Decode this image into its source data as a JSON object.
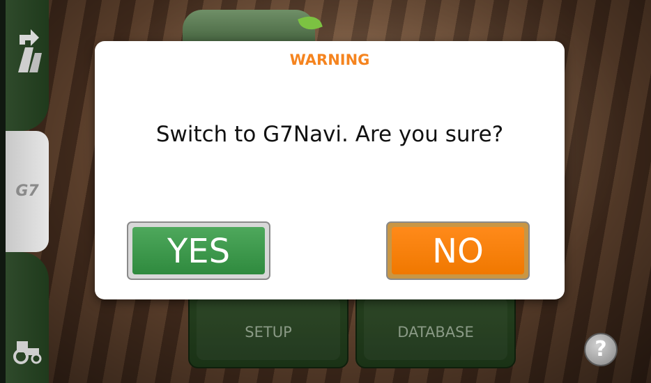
{
  "dialog": {
    "title": "WARNING",
    "message": "Switch to G7Navi. Are you sure?",
    "yes_label": "YES",
    "no_label": "NO"
  },
  "sidebar": {
    "logo_text": "G7"
  },
  "menu": {
    "setup_label": "SETUP",
    "database_label": "DATABASE"
  },
  "help": {
    "label": "?"
  },
  "colors": {
    "accent_orange": "#f5841f",
    "yes_green": "#3f9a4e",
    "no_orange": "#ff8200",
    "sidebar_green": "#2a4626"
  },
  "icons": [
    "route-icon",
    "g7-logo-icon",
    "tractor-icon",
    "help-icon"
  ]
}
